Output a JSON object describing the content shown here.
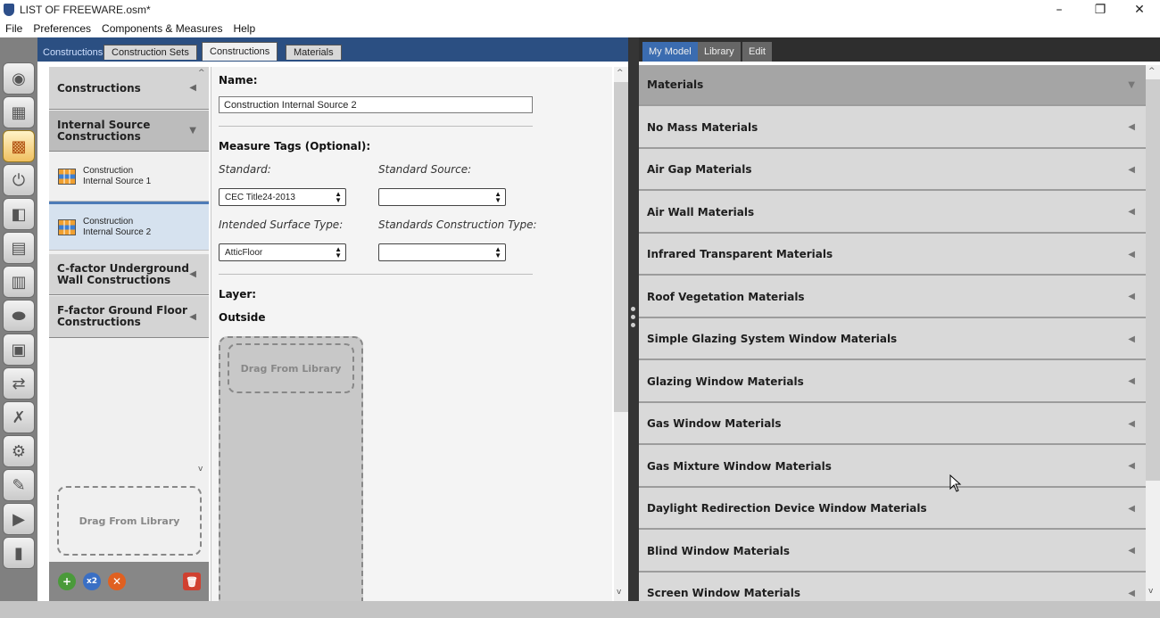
{
  "window": {
    "title": "LIST OF FREEWARE.osm*",
    "controls": {
      "minimize": "–",
      "maximize": "❐",
      "close": "✕"
    }
  },
  "menu": [
    "File",
    "Preferences",
    "Components & Measures",
    "Help"
  ],
  "toolbar_icons": [
    "site-icon",
    "schedules-icon",
    "constructions-icon",
    "loads-icon",
    "space-types-icon",
    "facility-icon",
    "spaces-icon",
    "thermal-zones-icon",
    "hvac-icon",
    "building-summary-icon",
    "variables-icon",
    "simulation-settings-icon",
    "scripts-icon",
    "run-icon",
    "results-icon"
  ],
  "center_tabs": {
    "section_label": "Constructions",
    "tabs": [
      {
        "label": "Construction Sets"
      },
      {
        "label": "Constructions"
      },
      {
        "label": "Materials"
      }
    ]
  },
  "list": {
    "categories": [
      {
        "label": "Constructions",
        "arrow": "◀"
      },
      {
        "label": "Internal Source\nConstructions",
        "arrow": "▼"
      },
      {
        "label": "C-factor Underground\nWall Constructions",
        "arrow": "◀"
      },
      {
        "label": "F-factor Ground Floor\nConstructions",
        "arrow": "◀"
      }
    ],
    "items": [
      {
        "label": "Construction\nInternal Source 1"
      },
      {
        "label": "Construction\nInternal Source 2"
      }
    ],
    "drag_label": "Drag From Library",
    "bottom_buttons": {
      "add": "+",
      "copy": "x2",
      "remove": "✕",
      "purge": "🗑"
    }
  },
  "editor": {
    "name_label": "Name:",
    "name_value": "Construction Internal Source 2",
    "measure_tags_label": "Measure Tags (Optional):",
    "standard_label": "Standard:",
    "standard_value": "CEC Title24-2013",
    "standard_source_label": "Standard Source:",
    "standard_source_value": "",
    "surface_type_label": "Intended Surface Type:",
    "surface_type_value": "AtticFloor",
    "construction_type_label": "Standards Construction Type:",
    "construction_type_value": "",
    "layer_label": "Layer:",
    "outside_label": "Outside",
    "drag_label": "Drag From Library"
  },
  "right_tabs": [
    {
      "label": "My Model"
    },
    {
      "label": "Library"
    },
    {
      "label": "Edit"
    }
  ],
  "library": {
    "header": {
      "label": "Materials",
      "arrow": "▼"
    },
    "rows": [
      {
        "label": "No Mass Materials",
        "arrow": "◀"
      },
      {
        "label": "Air Gap Materials",
        "arrow": "◀"
      },
      {
        "label": "Air Wall Materials",
        "arrow": "◀"
      },
      {
        "label": "Infrared Transparent Materials",
        "arrow": "◀"
      },
      {
        "label": "Roof Vegetation Materials",
        "arrow": "◀"
      },
      {
        "label": "Simple Glazing System Window Materials",
        "arrow": "◀"
      },
      {
        "label": "Glazing Window Materials",
        "arrow": "◀"
      },
      {
        "label": "Gas Window Materials",
        "arrow": "◀"
      },
      {
        "label": "Gas Mixture Window Materials",
        "arrow": "◀"
      },
      {
        "label": "Daylight Redirection Device Window Materials",
        "arrow": "◀"
      },
      {
        "label": "Blind Window Materials",
        "arrow": "◀"
      },
      {
        "label": "Screen Window Materials",
        "arrow": "◀"
      }
    ]
  },
  "colors": {
    "tab_bar_blue": "#2b4f82",
    "selected_blue": "#3b6cb0",
    "toolbar_gray": "#808080"
  }
}
